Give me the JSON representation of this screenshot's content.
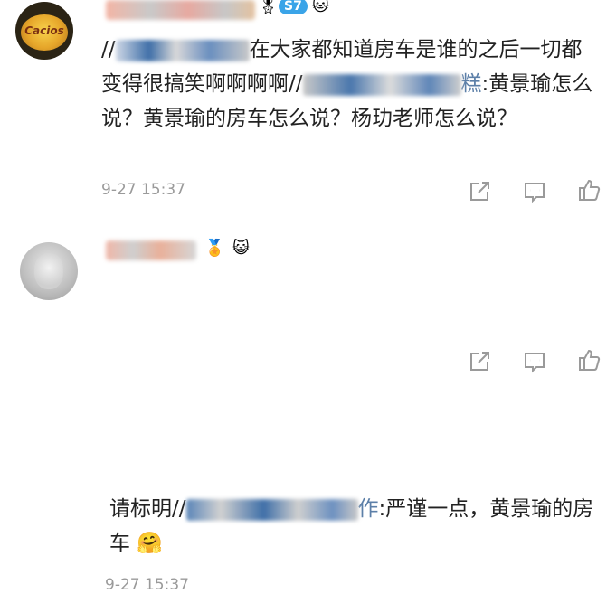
{
  "comments": [
    {
      "badge": "S7",
      "text_lead": "//",
      "text_tail": "在大家都知道房车是谁的之后一切都变得很搞笑啊啊啊啊//",
      "text_name_suffix": "糕",
      "text_body": ":黄景瑜怎么说？黄景瑜的房车怎么说？杨玏老师怎么说？",
      "time": "9-27 15:37",
      "avatar_text": "Cacios"
    },
    {
      "text_lead": "请标明//",
      "text_name_suffix": "作",
      "text_body": ":严谨一点，黄景瑜的房车",
      "time": "9-27 15:37"
    }
  ],
  "icons": {
    "share": "share-icon",
    "comment": "comment-icon",
    "like": "thumbs-up-icon"
  }
}
